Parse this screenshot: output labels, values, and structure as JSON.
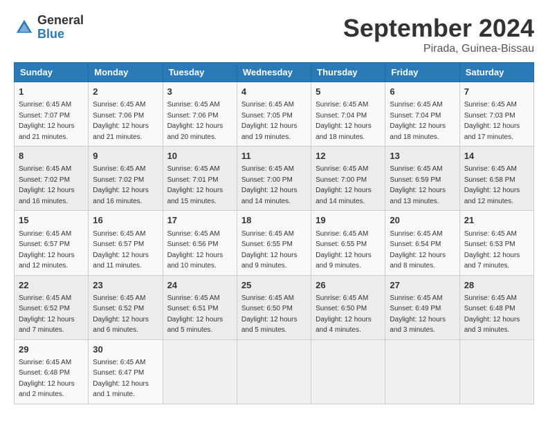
{
  "logo": {
    "general": "General",
    "blue": "Blue"
  },
  "header": {
    "month": "September 2024",
    "location": "Pirada, Guinea-Bissau"
  },
  "weekdays": [
    "Sunday",
    "Monday",
    "Tuesday",
    "Wednesday",
    "Thursday",
    "Friday",
    "Saturday"
  ],
  "weeks": [
    [
      {
        "day": "1",
        "sunrise": "6:45 AM",
        "sunset": "7:07 PM",
        "daylight": "12 hours and 21 minutes."
      },
      {
        "day": "2",
        "sunrise": "6:45 AM",
        "sunset": "7:06 PM",
        "daylight": "12 hours and 21 minutes."
      },
      {
        "day": "3",
        "sunrise": "6:45 AM",
        "sunset": "7:06 PM",
        "daylight": "12 hours and 20 minutes."
      },
      {
        "day": "4",
        "sunrise": "6:45 AM",
        "sunset": "7:05 PM",
        "daylight": "12 hours and 19 minutes."
      },
      {
        "day": "5",
        "sunrise": "6:45 AM",
        "sunset": "7:04 PM",
        "daylight": "12 hours and 18 minutes."
      },
      {
        "day": "6",
        "sunrise": "6:45 AM",
        "sunset": "7:04 PM",
        "daylight": "12 hours and 18 minutes."
      },
      {
        "day": "7",
        "sunrise": "6:45 AM",
        "sunset": "7:03 PM",
        "daylight": "12 hours and 17 minutes."
      }
    ],
    [
      {
        "day": "8",
        "sunrise": "6:45 AM",
        "sunset": "7:02 PM",
        "daylight": "12 hours and 16 minutes."
      },
      {
        "day": "9",
        "sunrise": "6:45 AM",
        "sunset": "7:02 PM",
        "daylight": "12 hours and 16 minutes."
      },
      {
        "day": "10",
        "sunrise": "6:45 AM",
        "sunset": "7:01 PM",
        "daylight": "12 hours and 15 minutes."
      },
      {
        "day": "11",
        "sunrise": "6:45 AM",
        "sunset": "7:00 PM",
        "daylight": "12 hours and 14 minutes."
      },
      {
        "day": "12",
        "sunrise": "6:45 AM",
        "sunset": "7:00 PM",
        "daylight": "12 hours and 14 minutes."
      },
      {
        "day": "13",
        "sunrise": "6:45 AM",
        "sunset": "6:59 PM",
        "daylight": "12 hours and 13 minutes."
      },
      {
        "day": "14",
        "sunrise": "6:45 AM",
        "sunset": "6:58 PM",
        "daylight": "12 hours and 12 minutes."
      }
    ],
    [
      {
        "day": "15",
        "sunrise": "6:45 AM",
        "sunset": "6:57 PM",
        "daylight": "12 hours and 12 minutes."
      },
      {
        "day": "16",
        "sunrise": "6:45 AM",
        "sunset": "6:57 PM",
        "daylight": "12 hours and 11 minutes."
      },
      {
        "day": "17",
        "sunrise": "6:45 AM",
        "sunset": "6:56 PM",
        "daylight": "12 hours and 10 minutes."
      },
      {
        "day": "18",
        "sunrise": "6:45 AM",
        "sunset": "6:55 PM",
        "daylight": "12 hours and 9 minutes."
      },
      {
        "day": "19",
        "sunrise": "6:45 AM",
        "sunset": "6:55 PM",
        "daylight": "12 hours and 9 minutes."
      },
      {
        "day": "20",
        "sunrise": "6:45 AM",
        "sunset": "6:54 PM",
        "daylight": "12 hours and 8 minutes."
      },
      {
        "day": "21",
        "sunrise": "6:45 AM",
        "sunset": "6:53 PM",
        "daylight": "12 hours and 7 minutes."
      }
    ],
    [
      {
        "day": "22",
        "sunrise": "6:45 AM",
        "sunset": "6:52 PM",
        "daylight": "12 hours and 7 minutes."
      },
      {
        "day": "23",
        "sunrise": "6:45 AM",
        "sunset": "6:52 PM",
        "daylight": "12 hours and 6 minutes."
      },
      {
        "day": "24",
        "sunrise": "6:45 AM",
        "sunset": "6:51 PM",
        "daylight": "12 hours and 5 minutes."
      },
      {
        "day": "25",
        "sunrise": "6:45 AM",
        "sunset": "6:50 PM",
        "daylight": "12 hours and 5 minutes."
      },
      {
        "day": "26",
        "sunrise": "6:45 AM",
        "sunset": "6:50 PM",
        "daylight": "12 hours and 4 minutes."
      },
      {
        "day": "27",
        "sunrise": "6:45 AM",
        "sunset": "6:49 PM",
        "daylight": "12 hours and 3 minutes."
      },
      {
        "day": "28",
        "sunrise": "6:45 AM",
        "sunset": "6:48 PM",
        "daylight": "12 hours and 3 minutes."
      }
    ],
    [
      {
        "day": "29",
        "sunrise": "6:45 AM",
        "sunset": "6:48 PM",
        "daylight": "12 hours and 2 minutes."
      },
      {
        "day": "30",
        "sunrise": "6:45 AM",
        "sunset": "6:47 PM",
        "daylight": "12 hours and 1 minute."
      },
      null,
      null,
      null,
      null,
      null
    ]
  ]
}
